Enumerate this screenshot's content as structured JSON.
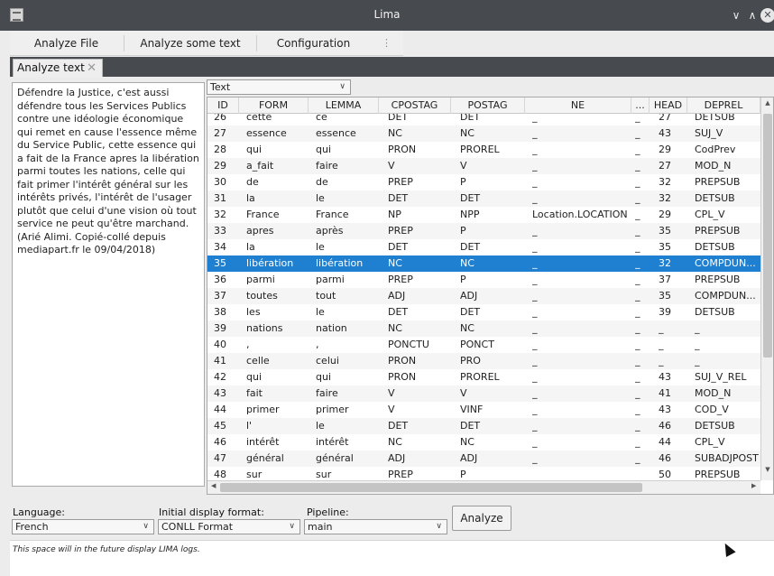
{
  "window": {
    "title": "Lima"
  },
  "menu": [
    "Analyze File",
    "Analyze some text",
    "Configuration"
  ],
  "tab": {
    "label": "Analyze text"
  },
  "input_text": "Défendre la Justice, c'est aussi défendre tous les Services Publics contre une idéologie économique qui remet en cause l'essence même du Service Public, cette essence qui a fait de la France apres la libération parmi toutes les nations, celle qui fait primer l'intérêt général sur les intérêts privés, l'intérêt de l'usager plutôt que celui d'une vision où tout service ne peut qu'être marchand. (Arié Alimi. Copié-collé depuis mediapart.fr le 09/04/2018)",
  "display_select": {
    "value": "Text"
  },
  "table": {
    "columns": [
      "ID",
      "FORM",
      "LEMMA",
      "CPOSTAG",
      "POSTAG",
      "NE",
      "...",
      "HEAD",
      "DEPREL"
    ],
    "selected_row_index": 9,
    "rows": [
      [
        "26",
        "cette",
        "ce",
        "DET",
        "DET",
        "_",
        "_",
        "27",
        "DETSUB"
      ],
      [
        "27",
        "essence",
        "essence",
        "NC",
        "NC",
        "_",
        "_",
        "43",
        "SUJ_V"
      ],
      [
        "28",
        "qui",
        "qui",
        "PRON",
        "PROREL",
        "_",
        "_",
        "29",
        "CodPrev"
      ],
      [
        "29",
        "a_fait",
        "faire",
        "V",
        "V",
        "_",
        "_",
        "27",
        "MOD_N"
      ],
      [
        "30",
        "de",
        "de",
        "PREP",
        "P",
        "_",
        "_",
        "32",
        "PREPSUB"
      ],
      [
        "31",
        "la",
        "le",
        "DET",
        "DET",
        "_",
        "_",
        "32",
        "DETSUB"
      ],
      [
        "32",
        "France",
        "France",
        "NP",
        "NPP",
        "Location.LOCATION",
        "_",
        "29",
        "CPL_V"
      ],
      [
        "33",
        "apres",
        "après",
        "PREP",
        "P",
        "_",
        "_",
        "35",
        "PREPSUB"
      ],
      [
        "34",
        "la",
        "le",
        "DET",
        "DET",
        "_",
        "_",
        "35",
        "DETSUB"
      ],
      [
        "35",
        "libération",
        "libération",
        "NC",
        "NC",
        "_",
        "_",
        "32",
        "COMPDUN..."
      ],
      [
        "36",
        "parmi",
        "parmi",
        "PREP",
        "P",
        "_",
        "_",
        "37",
        "PREPSUB"
      ],
      [
        "37",
        "toutes",
        "tout",
        "ADJ",
        "ADJ",
        "_",
        "_",
        "35",
        "COMPDUN..."
      ],
      [
        "38",
        "les",
        "le",
        "DET",
        "DET",
        "_",
        "_",
        "39",
        "DETSUB"
      ],
      [
        "39",
        "nations",
        "nation",
        "NC",
        "NC",
        "_",
        "_",
        "_",
        "_"
      ],
      [
        "40",
        ",",
        ",",
        "PONCTU",
        "PONCT",
        "_",
        "_",
        "_",
        "_"
      ],
      [
        "41",
        "celle",
        "celui",
        "PRON",
        "PRO",
        "_",
        "_",
        "_",
        "_"
      ],
      [
        "42",
        "qui",
        "qui",
        "PRON",
        "PROREL",
        "_",
        "_",
        "43",
        "SUJ_V_REL"
      ],
      [
        "43",
        "fait",
        "faire",
        "V",
        "V",
        "_",
        "_",
        "41",
        "MOD_N"
      ],
      [
        "44",
        "primer",
        "primer",
        "V",
        "VINF",
        "_",
        "_",
        "43",
        "COD_V"
      ],
      [
        "45",
        "l'",
        "le",
        "DET",
        "DET",
        "_",
        "_",
        "46",
        "DETSUB"
      ],
      [
        "46",
        "intérêt",
        "intérêt",
        "NC",
        "NC",
        "_",
        "_",
        "44",
        "CPL_V"
      ],
      [
        "47",
        "général",
        "général",
        "ADJ",
        "ADJ",
        "_",
        "_",
        "46",
        "SUBADJPOST"
      ],
      [
        "48",
        "sur",
        "sur",
        "PREP",
        "P",
        "",
        "",
        "50",
        "PREPSUB"
      ]
    ]
  },
  "controls": {
    "language": {
      "label": "Language:",
      "value": "French"
    },
    "format": {
      "label": "Initial display format:",
      "value": "CONLL Format"
    },
    "pipeline": {
      "label": "Pipeline:",
      "value": "main"
    },
    "analyze_label": "Analyze"
  },
  "log_message": "This space will in the future display LIMA logs.",
  "colors": {
    "titlebar": "#474a4f",
    "selection": "#1f7fd0"
  }
}
